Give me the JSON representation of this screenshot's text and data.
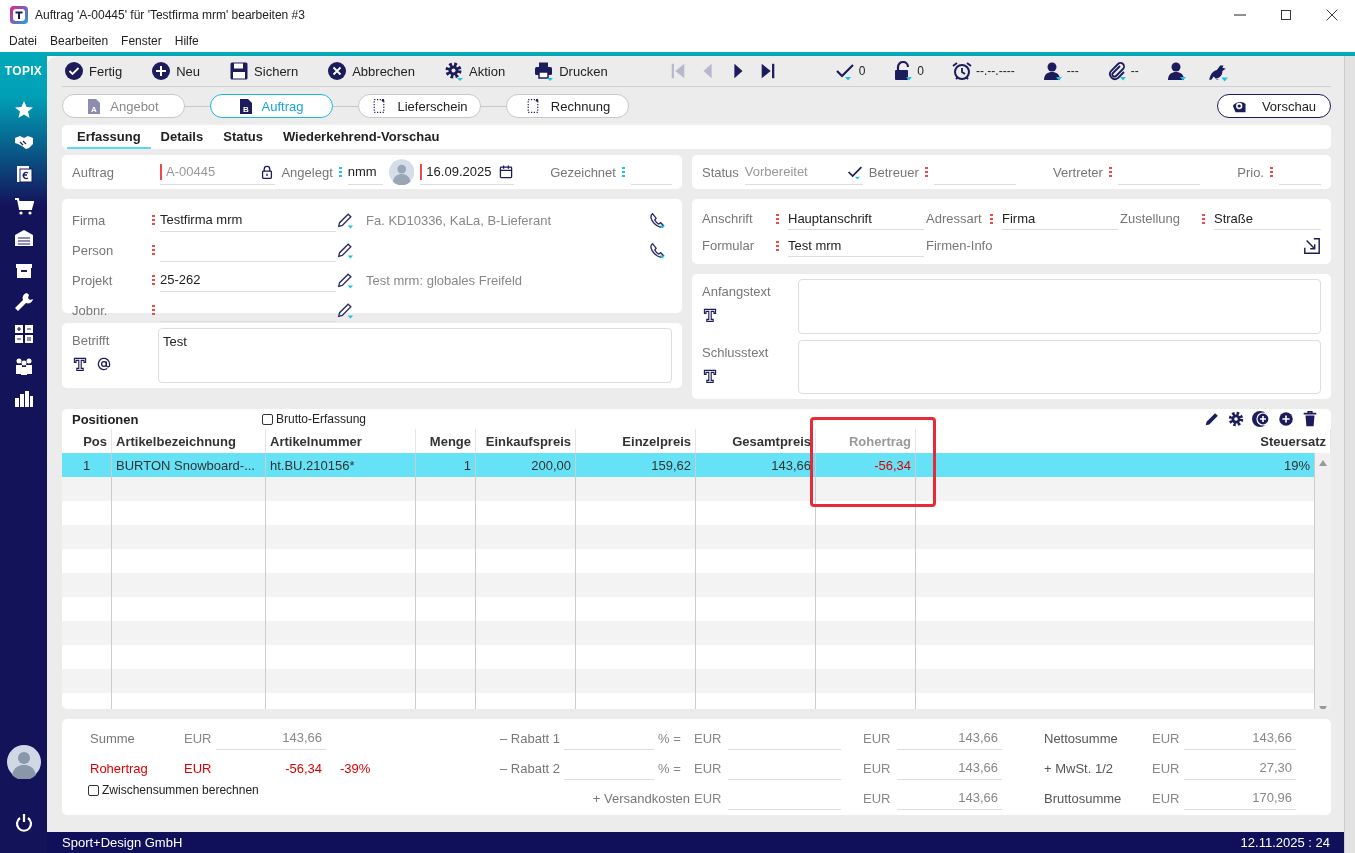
{
  "window": {
    "title": "Auftrag 'A-00445' für 'Testfirma mrm' bearbeiten #3"
  },
  "menu": [
    "Datei",
    "Bearbeiten",
    "Fenster",
    "Hilfe"
  ],
  "sidebar": {
    "logo": "TOPIX"
  },
  "toolbar": [
    "Fertig",
    "Neu",
    "Sichern",
    "Abbrechen",
    "Aktion",
    "Drucken"
  ],
  "record_nav": [
    {
      "disabled": true
    },
    {
      "disabled": true
    },
    {
      "disabled": false
    },
    {
      "disabled": false
    }
  ],
  "indicators": [
    "0",
    "0",
    "--.--.----",
    "---",
    "--"
  ],
  "workflow": [
    {
      "label": "Angebot",
      "badge": "A",
      "selected": false,
      "disabled": true
    },
    {
      "label": "Auftrag",
      "badge": "B",
      "selected": true,
      "disabled": false
    },
    {
      "label": "Lieferschein",
      "selected": false,
      "disabled": false
    },
    {
      "label": "Rechnung",
      "selected": false,
      "disabled": false
    }
  ],
  "preview_button": "Vorschau",
  "tabs": [
    {
      "label": "Erfassung",
      "selected": true
    },
    {
      "label": "Details",
      "selected": false
    },
    {
      "label": "Status",
      "selected": false
    },
    {
      "label": "Wiederkehrend-Vorschau",
      "selected": false
    }
  ],
  "order_header": {
    "number": {
      "label": "Auftrag",
      "value": "A-00445",
      "required": true
    },
    "created": {
      "label": "Angelegt",
      "user": "nmm",
      "date": "16.09.2025",
      "hint": true,
      "date_required": true
    },
    "signed": {
      "label": "Gezeichnet",
      "hint": true
    }
  },
  "status_header": {
    "status": {
      "label": "Status",
      "value": "Vorbereitet"
    },
    "owner": {
      "label": "Betreuer",
      "required": true
    },
    "deputy": {
      "label": "Vertreter",
      "required": true
    },
    "priority": {
      "label": "Prio.",
      "required": true
    }
  },
  "company": [
    {
      "label": "Firma",
      "value": "Testfirma mrm",
      "info": "Fa. KD10336, KaLa, B-Lieferant",
      "phone": true,
      "required": true
    },
    {
      "label": "Person",
      "phone": true,
      "required": true
    },
    {
      "label": "Projekt",
      "value": "25-262",
      "info": "Test mrm: globales Freifeld",
      "phone": false,
      "required": true
    },
    {
      "label": "Jobnr.",
      "phone": false,
      "required": true
    }
  ],
  "address": {
    "fields": [
      {
        "label": "Anschrift",
        "value": "Hauptanschrift",
        "required": true
      },
      {
        "label": "Adressart",
        "value": "Firma",
        "required": true
      },
      {
        "label": "Zustellung",
        "value": "Straße",
        "required": true
      }
    ],
    "form": {
      "label": "Formular",
      "value": "Test mrm",
      "required": true
    },
    "info_label": "Firmen-Info"
  },
  "subject": {
    "label": "Betrifft",
    "value": "Test"
  },
  "texts": [
    {
      "label": "Anfangstext"
    },
    {
      "label": "Schlusstext"
    }
  ],
  "positions": {
    "title": "Positionen",
    "gross_entry": {
      "label": "Brutto-Erfassung",
      "checked": false
    },
    "columns": [
      {
        "label": "Pos",
        "kind": "number",
        "highlighted": false
      },
      {
        "label": "Artikelbezeichnung",
        "kind": "text",
        "highlighted": false
      },
      {
        "label": "Artikelnummer",
        "kind": "text",
        "highlighted": false
      },
      {
        "label": "Menge",
        "kind": "number",
        "highlighted": false
      },
      {
        "label": "Einkaufspreis",
        "kind": "number",
        "highlighted": false
      },
      {
        "label": "Einzelpreis",
        "kind": "number",
        "highlighted": false
      },
      {
        "label": "Gesamtpreis",
        "kind": "number",
        "highlighted": false
      },
      {
        "label": "Rohertrag",
        "kind": "margin",
        "highlighted": true
      },
      {
        "label": "Steuersatz",
        "kind": "number",
        "highlighted": false
      }
    ],
    "rows": [
      {
        "selected": true,
        "cells": [
          "1",
          "BURTON Snowboard-...",
          "ht.BU.210156*",
          "1",
          "200,00",
          "159,62",
          "143,66",
          "-56,34",
          "19%"
        ]
      }
    ]
  },
  "totals": {
    "summary": [
      {
        "label": "Summe",
        "currency": "EUR",
        "value": "143,66",
        "negative": false
      },
      {
        "label": "Rohertrag",
        "currency": "EUR",
        "value": "-56,34",
        "percent": "-39%",
        "negative": true
      }
    ],
    "subtotals": {
      "label": "Zwischensummen berechnen",
      "checked": false
    },
    "adjustments": [
      {
        "label": "– Rabatt 1",
        "unit": "% =",
        "currency": "EUR",
        "result_currency": "EUR",
        "result": "143,66"
      },
      {
        "label": "– Rabatt 2",
        "unit": "% =",
        "currency": "EUR",
        "result_currency": "EUR",
        "result": "143,66"
      },
      {
        "label": "+ Versandkosten",
        "currency": "EUR",
        "result_currency": "EUR",
        "result": "143,66"
      }
    ],
    "sums": [
      {
        "label": "Nettosumme",
        "currency": "EUR",
        "value": "143,66"
      },
      {
        "label": "+ MwSt. 1/2",
        "currency": "EUR",
        "value": "27,30"
      },
      {
        "label": "Bruttosumme",
        "currency": "EUR",
        "value": "170,96"
      }
    ]
  },
  "status_bar": {
    "company": "Sport+Design GmbH",
    "datetime": "12.11.2025 : 24"
  }
}
